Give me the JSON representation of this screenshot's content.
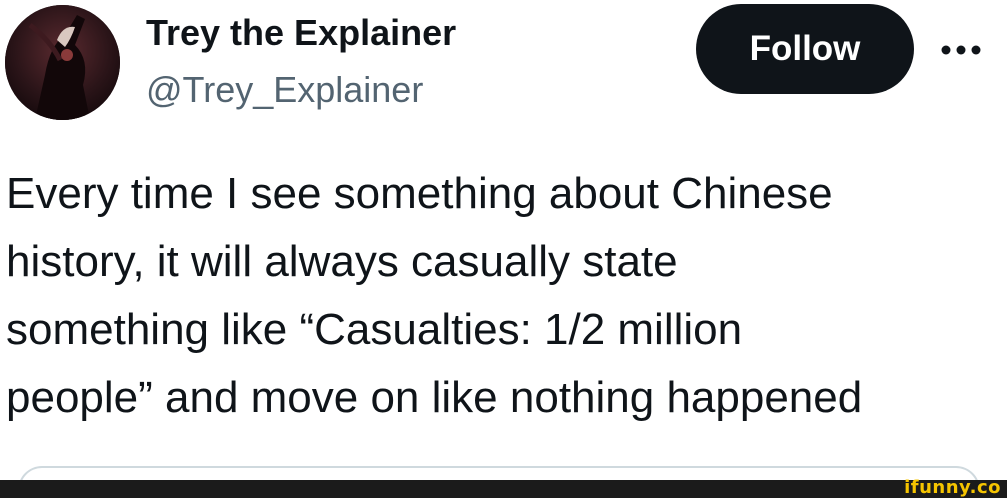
{
  "author": {
    "display_name": "Trey the Explainer",
    "handle": "@Trey_Explainer",
    "avatar_icon": "profile-avatar"
  },
  "actions": {
    "follow_label": "Follow",
    "more_icon": "more-horizontal-icon"
  },
  "tweet": {
    "text": "Every time I see something about Chinese\nhistory, it will always casually state\nsomething like “Casualties: 1/2 million\npeople” and move on like nothing happened"
  },
  "watermark": {
    "text": "ifunny.co"
  },
  "colors": {
    "text_primary": "#0f1419",
    "text_secondary": "#536471",
    "follow_bg": "#0f1419",
    "follow_text": "#ffffff",
    "border": "#cfd9de",
    "watermark": "#f5c400"
  }
}
